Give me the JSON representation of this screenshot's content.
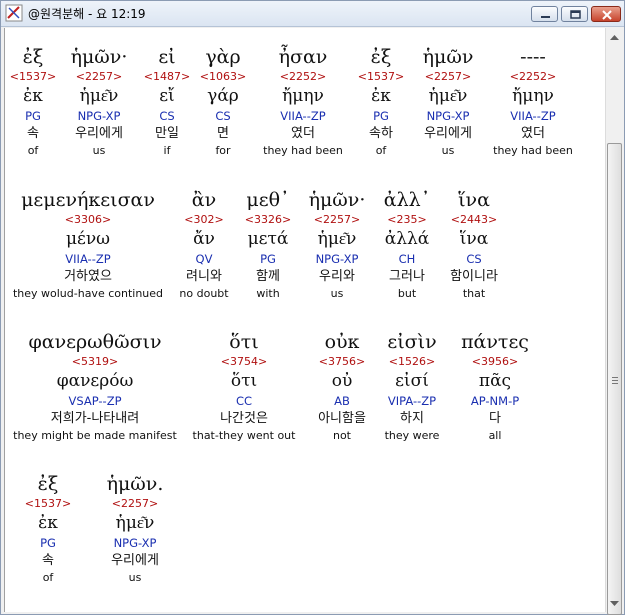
{
  "window": {
    "title": "@원격분해 - 요 12:19"
  },
  "verse_rows": [
    {
      "words": [
        {
          "greek": "ἐξ",
          "strong": "<1537>",
          "lemma": "ἐκ",
          "parse": "PG",
          "korean": "속",
          "english": "of"
        },
        {
          "greek": "ἡμῶν·",
          "strong": "<2257>",
          "lemma": "ἡμε͂ν",
          "parse": "NPG-XP",
          "korean": "우리에게",
          "english": "us"
        },
        {
          "greek": "εἰ",
          "strong": "<1487>",
          "lemma": "εἴ",
          "parse": "CS",
          "korean": "만일",
          "english": "if"
        },
        {
          "greek": "γὰρ",
          "strong": "<1063>",
          "lemma": "γάρ",
          "parse": "CS",
          "korean": "면",
          "english": "for"
        },
        {
          "greek": "ἦσαν",
          "strong": "<2252>",
          "lemma": "ἤμην",
          "parse": "VIIA--ZP",
          "korean": "였더",
          "english": "they had been"
        },
        {
          "greek": "ἐξ",
          "strong": "<1537>",
          "lemma": "ἐκ",
          "parse": "PG",
          "korean": "속하",
          "english": "of"
        },
        {
          "greek": "ἡμῶν",
          "strong": "<2257>",
          "lemma": "ἡμε͂ν",
          "parse": "NPG-XP",
          "korean": "우리에게",
          "english": "us"
        },
        {
          "greek": "----",
          "strong": "<2252>",
          "lemma": "ἤμην",
          "parse": "VIIA--ZP",
          "korean": "였더",
          "english": "they had been"
        }
      ]
    },
    {
      "words": [
        {
          "greek": "μεμενήκεισαν",
          "strong": "<3306>",
          "lemma": "μένω",
          "parse": "VIIA--ZP",
          "korean": "거하였으",
          "english": "they wolud-have continued"
        },
        {
          "greek": "ἂν",
          "strong": "<302>",
          "lemma": "ἄν",
          "parse": "QV",
          "korean": "려니와",
          "english": "no doubt"
        },
        {
          "greek": "μεθ᾽",
          "strong": "<3326>",
          "lemma": "μετά",
          "parse": "PG",
          "korean": "함께",
          "english": "with"
        },
        {
          "greek": "ἡμῶν·",
          "strong": "<2257>",
          "lemma": "ἡμε͂ν",
          "parse": "NPG-XP",
          "korean": "우리와",
          "english": "us"
        },
        {
          "greek": "ἀλλ᾽",
          "strong": "<235>",
          "lemma": "ἀλλά",
          "parse": "CH",
          "korean": "그러나",
          "english": "but"
        },
        {
          "greek": "ἵνα",
          "strong": "<2443>",
          "lemma": "ἵνα",
          "parse": "CS",
          "korean": "함이니라",
          "english": "that"
        }
      ]
    },
    {
      "words": [
        {
          "greek": "φανερωθῶσιν",
          "strong": "<5319>",
          "lemma": "φανερόω",
          "parse": "VSAP--ZP",
          "korean": "저희가-나타내려",
          "english": "they might be made manifest"
        },
        {
          "greek": "ὅτι",
          "strong": "<3754>",
          "lemma": "ὅτι",
          "parse": "CC",
          "korean": "나간것은",
          "english": "that-they went out"
        },
        {
          "greek": "οὐκ",
          "strong": "<3756>",
          "lemma": "οὐ",
          "parse": "AB",
          "korean": "아니함을",
          "english": "not"
        },
        {
          "greek": "εἰσὶν",
          "strong": "<1526>",
          "lemma": "εἰσί",
          "parse": "VIPA--ZP",
          "korean": "하지",
          "english": "they were"
        },
        {
          "greek": "πάντες",
          "strong": "<3956>",
          "lemma": "πᾶς",
          "parse": "AP-NM-P",
          "korean": "다",
          "english": "all"
        }
      ]
    },
    {
      "words": [
        {
          "greek": "ἐξ",
          "strong": "<1537>",
          "lemma": "ἐκ",
          "parse": "PG",
          "korean": "속",
          "english": "of"
        },
        {
          "greek": "ἡμῶν.",
          "strong": "<2257>",
          "lemma": "ἡμε͂ν",
          "parse": "NPG-XP",
          "korean": "우리에게",
          "english": "us"
        }
      ]
    }
  ],
  "colors": {
    "strong_number": "#b01010",
    "parse_code": "#1a2fb0",
    "text": "#111111"
  },
  "icons": {
    "app": "app-logo-icon",
    "minimize": "minimize-icon",
    "maximize": "maximize-icon",
    "close": "close-icon",
    "scroll_up": "scroll-up-arrow-icon",
    "scroll_down": "scroll-down-arrow-icon"
  }
}
